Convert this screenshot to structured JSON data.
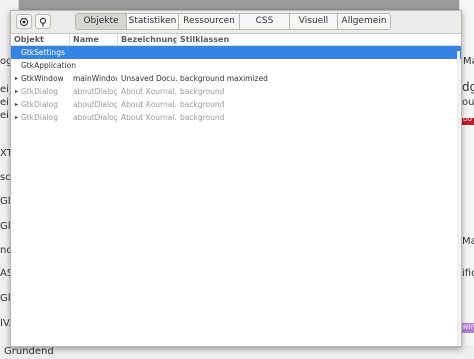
{
  "window": {
    "toolbar": {
      "button1_icon": "target-select-icon",
      "button2_icon": "magnifier-icon"
    },
    "tabs": [
      {
        "label": "Objekte",
        "active": true
      },
      {
        "label": "Statistiken",
        "active": false
      },
      {
        "label": "Ressourcen",
        "active": false
      },
      {
        "label": "CSS",
        "active": false
      },
      {
        "label": "Visuell",
        "active": false
      },
      {
        "label": "Allgemein",
        "active": false
      }
    ],
    "columns": [
      "Objekt",
      "Name",
      "Bezeichnung",
      "Stilklassen"
    ],
    "rows": [
      {
        "object": "GtkSettings",
        "name": "",
        "label": "",
        "classes": "",
        "expander": "",
        "selected": true,
        "dim": false
      },
      {
        "object": "GtkApplication",
        "name": "",
        "label": "",
        "classes": "",
        "expander": "",
        "selected": false,
        "dim": false
      },
      {
        "object": "GtkWindow",
        "name": "mainWindow",
        "label": "Unsaved Docu...",
        "classes": "background maximized",
        "expander": "▸",
        "selected": false,
        "dim": false
      },
      {
        "object": "GtkDialog",
        "name": "aboutDialog",
        "label": "About Xournal...",
        "classes": "background",
        "expander": "▸",
        "selected": false,
        "dim": true
      },
      {
        "object": "GtkDialog",
        "name": "aboutDialog",
        "label": "About Xournal...",
        "classes": "background",
        "expander": "▸",
        "selected": false,
        "dim": true
      },
      {
        "object": "GtkDialog",
        "name": "aboutDialog",
        "label": "About Xournal...",
        "classes": "background",
        "expander": "▸",
        "selected": false,
        "dim": true
      }
    ]
  },
  "background_app": {
    "left_fragments": [
      "og",
      "ei",
      "ei",
      "ei",
      "XT",
      "sc",
      "Gl",
      "Gl",
      "nd",
      "ASI",
      "Gl",
      "IVA",
      "Grundend"
    ],
    "right_fragments": [
      "Ma",
      "dgi",
      "ou",
      "DU",
      "Ma",
      "ific",
      "win"
    ]
  }
}
